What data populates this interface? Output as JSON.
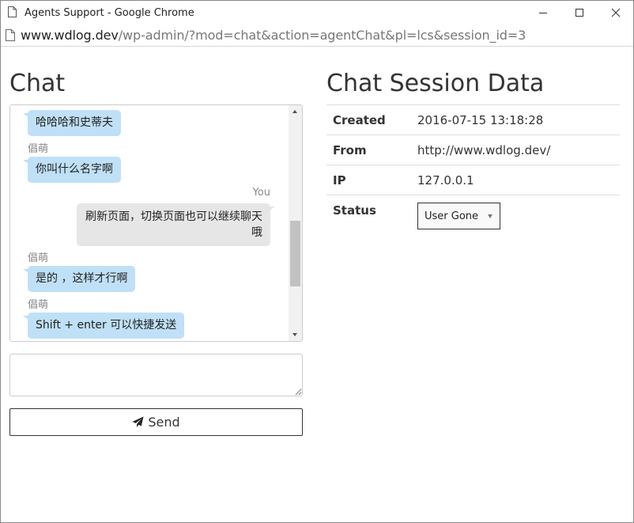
{
  "window": {
    "title": "Agents Support - Google Chrome"
  },
  "address": {
    "host": "www.wdlog.dev",
    "path": "/wp-admin/?mod=chat&action=agentChat&pl=lcs&session_id=3"
  },
  "chat": {
    "heading": "Chat",
    "messages": [
      {
        "type": "agent",
        "text": "哈哈哈和史蒂夫"
      },
      {
        "type": "sender",
        "text": "倡萌"
      },
      {
        "type": "agent",
        "text": "你叫什么名字啊"
      },
      {
        "type": "sender",
        "text": "You"
      },
      {
        "type": "user",
        "line1": "刷新页面，切换页面也可以继续聊天",
        "line2": "哦"
      },
      {
        "type": "sender",
        "text": "倡萌"
      },
      {
        "type": "agent",
        "text": "是的 ，这样才行啊"
      },
      {
        "type": "sender",
        "text": "倡萌"
      },
      {
        "type": "agent",
        "text": "Shift + enter 可以快捷发送"
      }
    ],
    "reply_placeholder": "",
    "send_label": "Send"
  },
  "session": {
    "heading": "Chat Session Data",
    "rows": [
      {
        "label": "Created",
        "value": "2016-07-15 13:18:28"
      },
      {
        "label": "From",
        "value": "http://www.wdlog.dev/"
      },
      {
        "label": "IP",
        "value": "127.0.0.1"
      }
    ],
    "status_label": "Status",
    "status_value": "User Gone"
  },
  "colors": {
    "agent_bubble": "#bfe0f6",
    "user_bubble": "#e6e6e6"
  },
  "icons": {
    "send": "paper-plane-icon",
    "page": "document-icon"
  }
}
